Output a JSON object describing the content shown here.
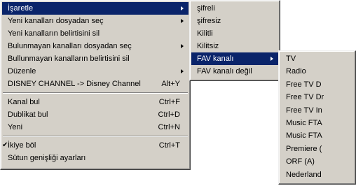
{
  "main_menu": {
    "items": [
      {
        "label": "İşaretle",
        "shortcut": "",
        "submenu": true,
        "selected": true
      },
      {
        "label": "Yeni kanalları dosyadan seç",
        "shortcut": "",
        "submenu": true
      },
      {
        "label": "Yeni kanalların belirtisini sil",
        "shortcut": ""
      },
      {
        "label": "Bulunmayan kanalları dosyadan seç",
        "shortcut": "",
        "submenu": true
      },
      {
        "label": "Bullunmayan kanalların belirtisini sil",
        "shortcut": ""
      },
      {
        "label": "Düzenle",
        "shortcut": "",
        "submenu": true
      },
      {
        "label": "DISNEY CHANNEL -> Disney Channel",
        "shortcut": "Alt+Y"
      },
      {
        "label": "Kanal bul",
        "shortcut": "Ctrl+F"
      },
      {
        "label": "Dublikat bul",
        "shortcut": "Ctrl+D"
      },
      {
        "label": "Yeni",
        "shortcut": "Ctrl+N"
      },
      {
        "label": "İkiye böl",
        "shortcut": "Ctrl+T",
        "checked": true
      },
      {
        "label": "Sütun genişliği ayarları",
        "shortcut": ""
      }
    ]
  },
  "mark_submenu": {
    "items": [
      {
        "label": "şifreli"
      },
      {
        "label": "şifresiz"
      },
      {
        "label": "Kilitli"
      },
      {
        "label": "Kilitsiz"
      },
      {
        "label": "FAV kanalı",
        "submenu": true,
        "selected": true
      },
      {
        "label": "FAV kanalı değil"
      }
    ]
  },
  "fav_submenu": {
    "items": [
      {
        "label": "TV"
      },
      {
        "label": "Radio"
      },
      {
        "label": "Free TV D"
      },
      {
        "label": "Free TV Dr"
      },
      {
        "label": "Free TV In"
      },
      {
        "label": "Music FTA"
      },
      {
        "label": "Music FTA"
      },
      {
        "label": "Premiere ("
      },
      {
        "label": "ORF (A)"
      },
      {
        "label": "Nederland"
      }
    ]
  },
  "colors": {
    "menu_bg": "#d4d0c8",
    "highlight": "#0a246a",
    "highlight_text": "#ffffff"
  }
}
